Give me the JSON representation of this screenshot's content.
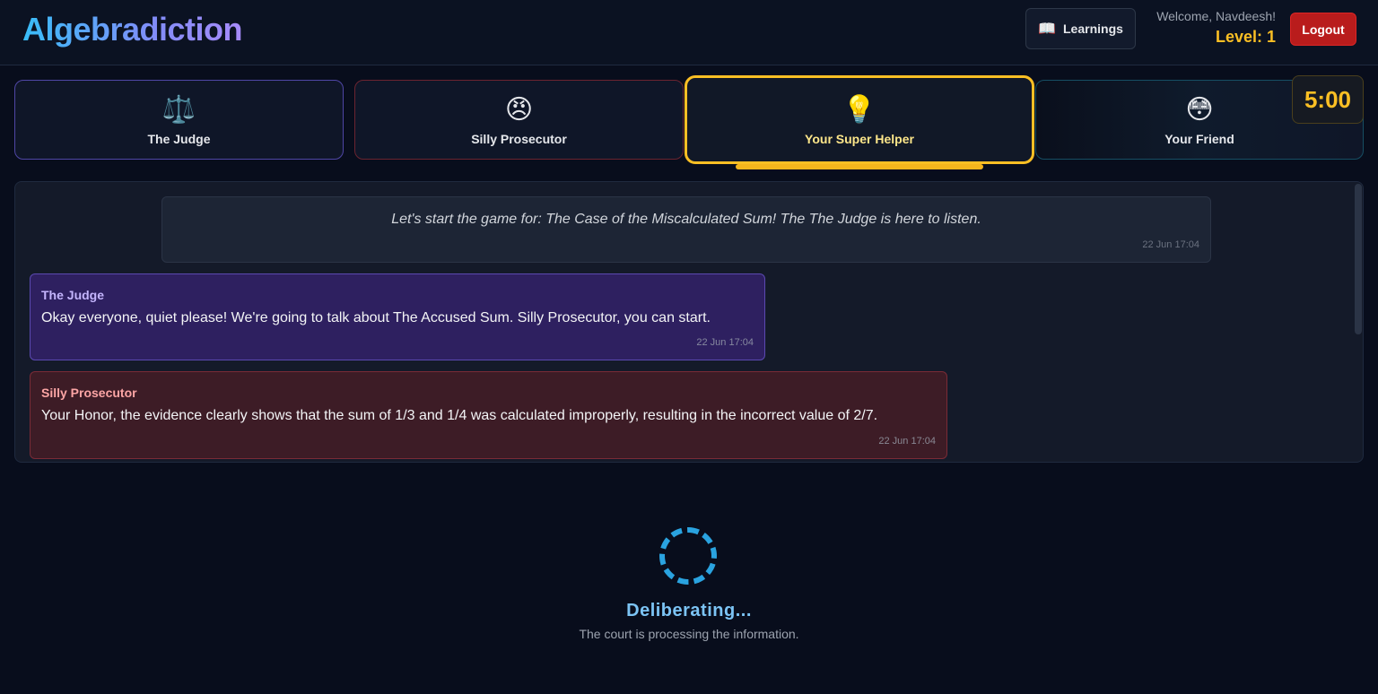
{
  "header": {
    "brand": "Algebradiction",
    "learnings_label": "Learnings",
    "learnings_icon": "open-book-icon",
    "welcome": "Welcome, Navdeesh!",
    "level": "Level: 1",
    "logout_label": "Logout"
  },
  "characters": [
    {
      "name": "The Judge",
      "emoji": "⚖️",
      "icon": "scales-icon"
    },
    {
      "name": "Silly Prosecutor",
      "emoji": "😠",
      "icon": "angry-face-icon"
    },
    {
      "name": "Your Super Helper",
      "emoji": "💡",
      "icon": "lightbulb-icon",
      "selected": true
    },
    {
      "name": "Your Friend",
      "emoji": "😳",
      "icon": "worried-face-icon"
    }
  ],
  "timer": "5:00",
  "chat": {
    "system_message": {
      "text": "Let's start the game for: The Case of the Miscalculated Sum! The The Judge is here to listen.",
      "timestamp": "22 Jun 17:04"
    },
    "messages": [
      {
        "sender": "The Judge",
        "text": "Okay everyone, quiet please! We're going to talk about The Accused Sum. Silly Prosecutor, you can start.",
        "timestamp": "22 Jun 17:04"
      },
      {
        "sender": "Silly Prosecutor",
        "text": "Your Honor, the evidence clearly shows that the sum of 1/3 and 1/4 was calculated improperly, resulting in the incorrect value of 2/7.",
        "timestamp": "22 Jun 17:04"
      }
    ]
  },
  "status": {
    "title": "Deliberating...",
    "subtitle": "The court is processing the information."
  },
  "colors": {
    "accent_gold": "#fbbf24",
    "judge_purple": "#2e2060",
    "prosecutor_red": "#3d1c26",
    "spinner_blue": "#2aa3e0",
    "logout_red": "#b91c1c"
  }
}
